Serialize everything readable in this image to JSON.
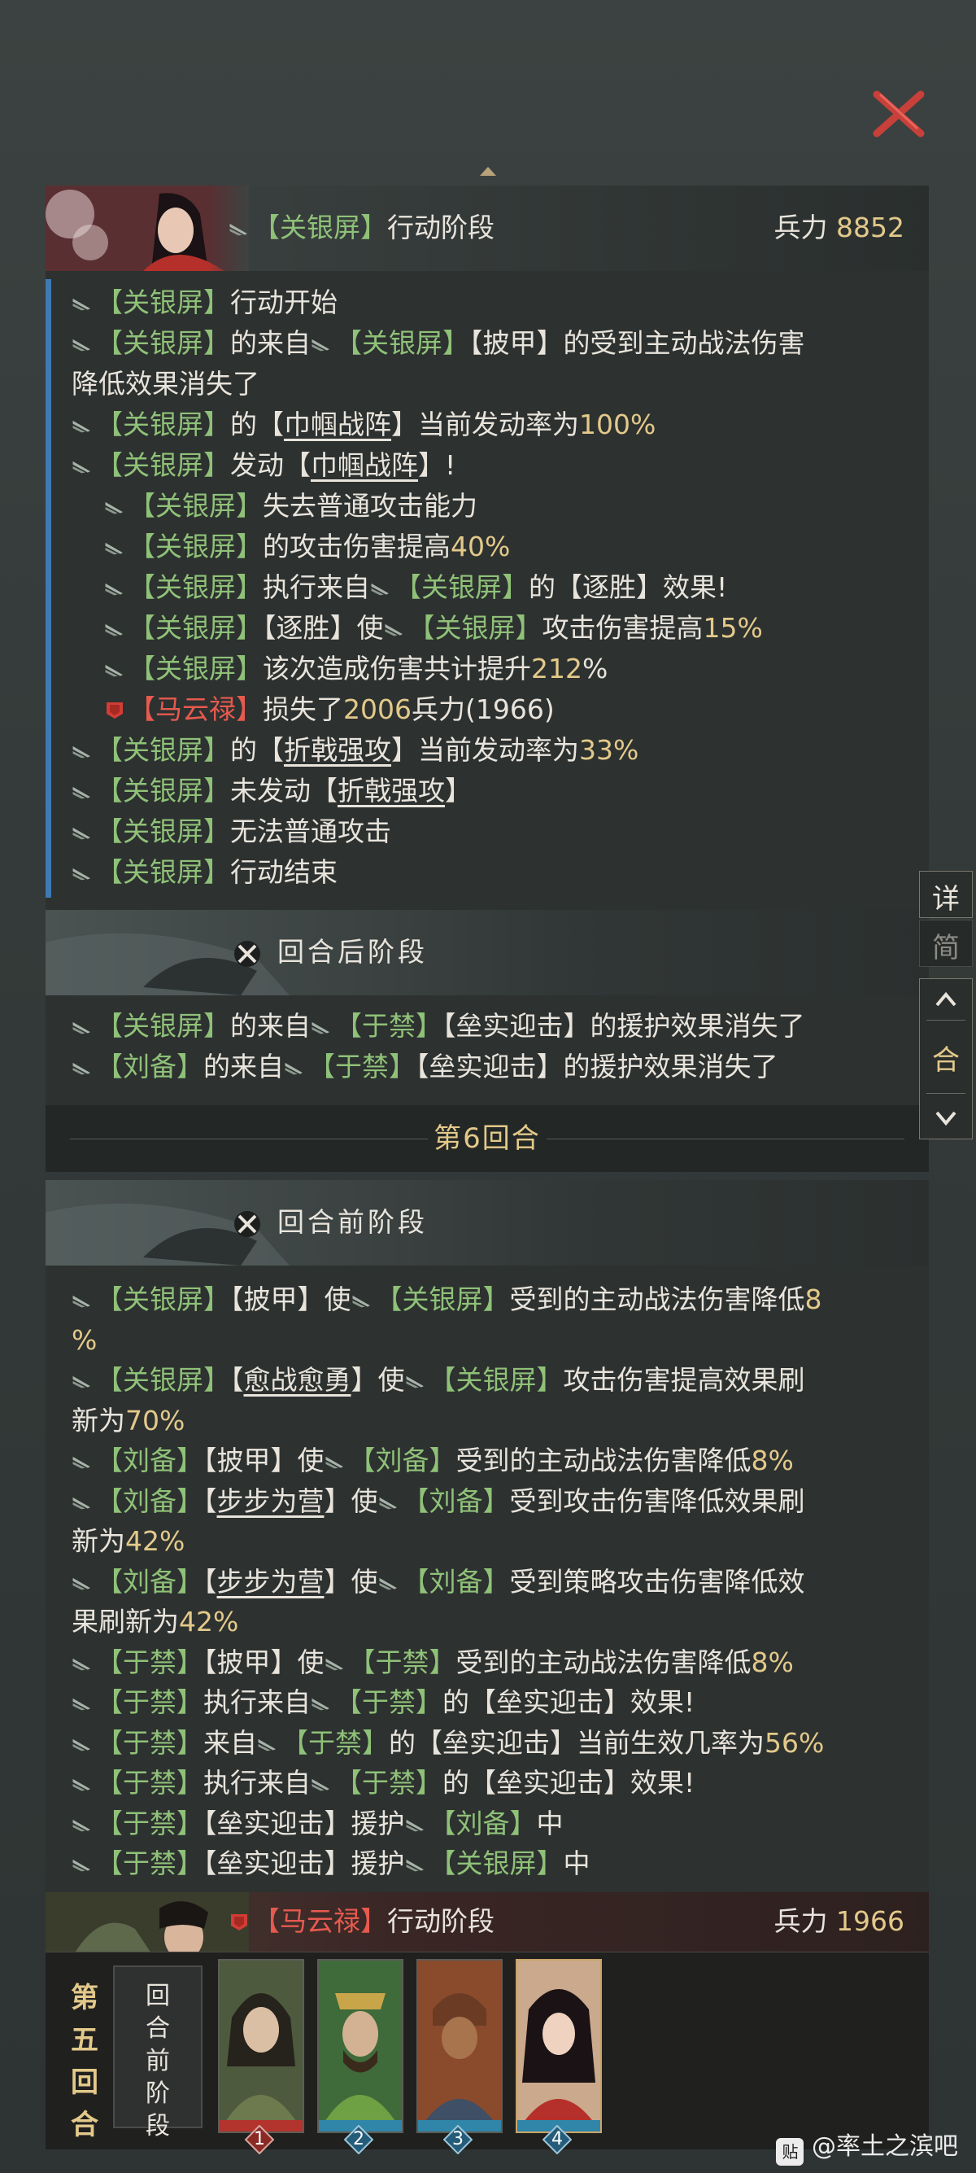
{
  "colors": {
    "ally_name": "#8fc178",
    "enemy_name": "#e65a4f",
    "highlight_number": "#e3c98a",
    "close": "#c8403a"
  },
  "close_icon": "close-x-icon",
  "block1": {
    "header_name": "【关银屏】",
    "header_action": "行动阶段",
    "troops_label": "兵力",
    "troops_value": "8852",
    "lines": [
      {
        "a": "【关银屏】",
        "b": "行动开始"
      },
      {
        "a": "【关银屏】",
        "b": "的来自",
        "c": "【关银屏】",
        "d": "【披甲】的受到主动战法伤害"
      },
      {
        "a": "降低效果消失了"
      },
      {
        "a": "【关银屏】",
        "b": "的【",
        "c": "巾帼战阵",
        "d": "】当前发动率为",
        "e": "100%"
      },
      {
        "a": "【关银屏】",
        "b": "发动【",
        "c": "巾帼战阵",
        "d": "】!"
      },
      {
        "a": "【关银屏】",
        "b": "失去普通攻击能力"
      },
      {
        "a": "【关银屏】",
        "b": "的攻击伤害提高",
        "c": "40%"
      },
      {
        "a": "【关银屏】",
        "b": "执行来自",
        "c": "【关银屏】",
        "d": "的【逐胜】效果!"
      },
      {
        "a": "【关银屏】",
        "b": "【逐胜】使",
        "c": "【关银屏】",
        "d": "攻击伤害提高",
        "e": "15%"
      },
      {
        "a": "【关银屏】",
        "b": "该次造成伤害共计提升",
        "c": "212",
        "d": "%"
      },
      {
        "a": "【马云禄】",
        "b": "损失了",
        "c": "2006",
        "d": "兵力(1966)"
      },
      {
        "a": "【关银屏】",
        "b": "的【",
        "c": "折戟强攻",
        "d": "】当前发动率为",
        "e": "33%"
      },
      {
        "a": "【关银屏】",
        "b": "未发动【",
        "c": "折戟强攻",
        "d": "】"
      },
      {
        "a": "【关银屏】",
        "b": "无法普通攻击"
      },
      {
        "a": "【关银屏】",
        "b": "行动结束"
      }
    ]
  },
  "after_phase": {
    "title": "回合后阶段",
    "lines": [
      {
        "a": "【关银屏】",
        "b": "的来自",
        "c": "【于禁】",
        "d": "【垒实迎击】的援护效果消失了"
      },
      {
        "a": "【刘备】",
        "b": "的来自",
        "c": "【于禁】",
        "d": "【垒实迎击】的援护效果消失了"
      }
    ]
  },
  "round_separator": "第6回合",
  "before_phase": {
    "title": "回合前阶段",
    "lines": [
      {
        "a": "【关银屏】",
        "b": "【披甲】使",
        "c": "【关银屏】",
        "d": "受到的主动战法伤害降低",
        "e": "8"
      },
      {
        "a": "%"
      },
      {
        "a": "【关银屏】",
        "b": "【",
        "c": "愈战愈勇",
        "d": "】使",
        "e": "【关银屏】",
        "f": "攻击伤害提高效果刷"
      },
      {
        "a": "新为",
        "b": "70%"
      },
      {
        "a": "【刘备】",
        "b": "【披甲】使",
        "c": "【刘备】",
        "d": "受到的主动战法伤害降低",
        "e": "8%"
      },
      {
        "a": "【刘备】",
        "b": "【",
        "c": "步步为营",
        "d": "】使",
        "e": "【刘备】",
        "f": "受到攻击伤害降低效果刷"
      },
      {
        "a": "新为",
        "b": "42%"
      },
      {
        "a": "【刘备】",
        "b": "【",
        "c": "步步为营",
        "d": "】使",
        "e": "【刘备】",
        "f": "受到策略攻击伤害降低效"
      },
      {
        "a": "果刷新为",
        "b": "42%"
      },
      {
        "a": "【于禁】",
        "b": "【披甲】使",
        "c": "【于禁】",
        "d": "受到的主动战法伤害降低",
        "e": "8%"
      },
      {
        "a": "【于禁】",
        "b": "执行来自",
        "c": "【于禁】",
        "d": "的【垒实迎击】效果!"
      },
      {
        "a": "【于禁】",
        "b": "来自",
        "c": "【于禁】",
        "d": "的【垒实迎击】当前生效几率为",
        "e": "56%"
      },
      {
        "a": "【于禁】",
        "b": "执行来自",
        "c": "【于禁】",
        "d": "的【垒实迎击】效果!"
      },
      {
        "a": "【于禁】",
        "b": "【垒实迎击】援护",
        "c": "【刘备】",
        "d": "中"
      },
      {
        "a": "【于禁】",
        "b": "【垒实迎击】援护",
        "c": "【关银屏】",
        "d": "中"
      }
    ]
  },
  "block2": {
    "header_name": "【马云禄】",
    "header_action": "行动阶段",
    "troops_label": "兵力",
    "troops_value": "1966"
  },
  "side_controls": {
    "detail": "详",
    "simple": "简",
    "round": "合"
  },
  "bottom": {
    "round_label": [
      "第",
      "五",
      "回",
      "合"
    ],
    "phase_label": [
      "回",
      "合",
      "前",
      "阶",
      "段"
    ],
    "heroes": [
      {
        "badge": "1",
        "side": "enemy"
      },
      {
        "badge": "2",
        "side": "ally"
      },
      {
        "badge": "3",
        "side": "ally"
      },
      {
        "badge": "4",
        "side": "ally"
      }
    ]
  },
  "watermark": "@率土之滨吧"
}
